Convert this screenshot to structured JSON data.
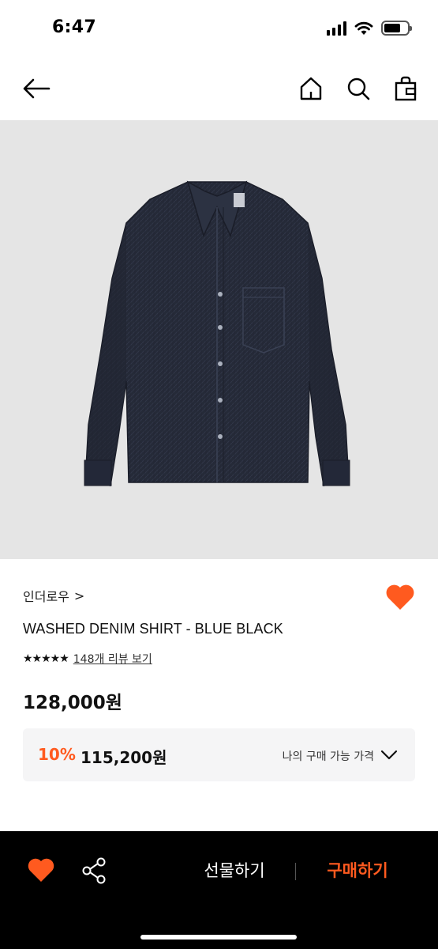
{
  "status_bar": {
    "time": "6:47",
    "battery_level": 0.7
  },
  "nav": {
    "back_icon": "arrow-left-icon",
    "home_icon": "home-icon",
    "search_icon": "search-icon",
    "bag_icon": "shopping-bag-icon"
  },
  "product": {
    "image_alt_icon": "denim-shirt-image",
    "brand": "인더로우",
    "brand_chevron": ">",
    "name": "WASHED DENIM SHIRT - BLUE BLACK",
    "stars": "★★★★★",
    "rating": 5,
    "review_link": "148개 리뷰 보기",
    "price": "128,000원",
    "wishlisted": true
  },
  "discount": {
    "rate": "10%",
    "price": "115,200원",
    "label": "나의 구매 가능 가격"
  },
  "bottom_bar": {
    "gift_label": "선물하기",
    "buy_label": "구매하기"
  },
  "colors": {
    "accent": "#ff5a1f",
    "bottom_bar_bg": "#000000",
    "image_bg": "#e5e5e5",
    "discount_bg": "#f5f5f6"
  }
}
